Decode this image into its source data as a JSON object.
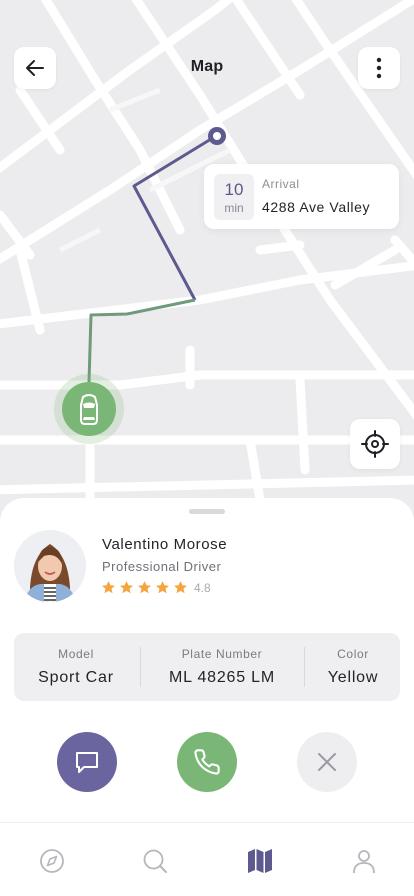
{
  "header": {
    "title": "Map",
    "back_icon": "arrow-left-icon",
    "more_icon": "more-vertical-icon"
  },
  "arrival": {
    "minutes": "10",
    "unit": "min",
    "label": "Arrival",
    "address": "4288 Ave Valley"
  },
  "driver": {
    "name": "Valentino Morose",
    "role": "Professional Driver",
    "rating": 4.8,
    "rating_text": "4.8",
    "stars": 5
  },
  "car": {
    "model_label": "Model",
    "model": "Sport Car",
    "plate_label": "Plate Number",
    "plate": "ML 48265 LM",
    "color_label": "Color",
    "color": "Yellow"
  },
  "actions": [
    {
      "name": "chat",
      "icon": "chat-icon"
    },
    {
      "name": "call",
      "icon": "phone-icon"
    },
    {
      "name": "cancel",
      "icon": "close-icon"
    }
  ],
  "tabs": [
    {
      "name": "discover",
      "icon": "compass-icon",
      "active": false
    },
    {
      "name": "search",
      "icon": "search-icon",
      "active": false
    },
    {
      "name": "map",
      "icon": "map-icon",
      "active": true
    },
    {
      "name": "profile",
      "icon": "user-icon",
      "active": false
    }
  ],
  "colors": {
    "accent_purple": "#6a659e",
    "accent_green": "#7ab777",
    "star": "#f5a540",
    "route_purple": "#5c5a8e",
    "route_green": "#6d9b7c"
  }
}
